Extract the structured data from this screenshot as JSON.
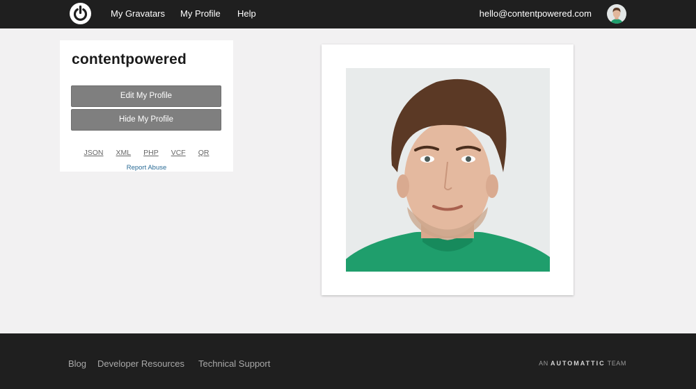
{
  "header": {
    "logo": "gravatar-logo-icon",
    "nav": [
      {
        "label": "My Gravatars"
      },
      {
        "label": "My Profile"
      },
      {
        "label": "Help"
      }
    ],
    "user_email": "hello@contentpowered.com",
    "user_avatar": "user-avatar"
  },
  "profile": {
    "username": "contentpowered",
    "edit_label": "Edit My Profile",
    "hide_label": "Hide My Profile",
    "formats": [
      "JSON",
      "XML",
      "PHP",
      "VCF",
      "QR"
    ],
    "report_label": "Report Abuse"
  },
  "footer": {
    "links": [
      "Blog",
      "Developer Resources",
      "Technical Support"
    ],
    "brand_prefix": "AN",
    "brand_name": "AUTOMATTIC",
    "brand_suffix": "TEAM"
  },
  "colors": {
    "bar": "#1f1f1f",
    "background": "#f2f1f2",
    "button": "#7f7f7f",
    "link_blue": "#2a6b96"
  }
}
